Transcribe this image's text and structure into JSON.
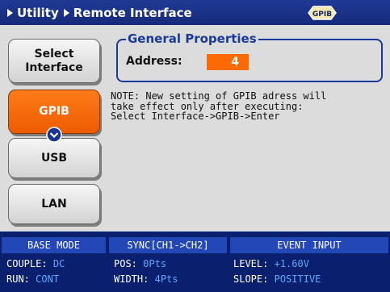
{
  "breadcrumb": [
    "Utility",
    "Remote Interface"
  ],
  "title_badge": "GPIB",
  "sidebar": {
    "items": [
      {
        "label": "Select\nInterface"
      },
      {
        "label": "GPIB"
      },
      {
        "label": "USB"
      },
      {
        "label": "LAN"
      }
    ]
  },
  "general_properties": {
    "title": "General Properties",
    "address_label": "Address:",
    "address_value": "4"
  },
  "note": "NOTE: New setting of GPIB adress will\ntake effect only after executing:\nSelect Interface->GPIB->Enter",
  "status": {
    "base_mode": {
      "header": "BASE MODE",
      "couple_label": "COUPLE:",
      "couple_value": "DC",
      "run_label": "RUN:",
      "run_value": "CONT"
    },
    "sync": {
      "header": "SYNC[CH1->CH2]",
      "pos_label": "POS:",
      "pos_value": "0Pts",
      "width_label": "WIDTH:",
      "width_value": "4Pts"
    },
    "event_input": {
      "header": "EVENT INPUT",
      "level_label": "LEVEL:",
      "level_value": "+1.60V",
      "slope_label": "SLOPE:",
      "slope_value": "POSITIVE"
    }
  },
  "colors": {
    "accent": "#ff6a00",
    "title_bar": "#1a3290",
    "status_bar": "#0a1f6e",
    "value_text": "#5fa8ff"
  },
  "icons": {
    "breadcrumb_separator": "triangle-right-icon",
    "gpib_badge": "gpib-connector-icon",
    "expand": "chevron-down-circle-icon"
  }
}
